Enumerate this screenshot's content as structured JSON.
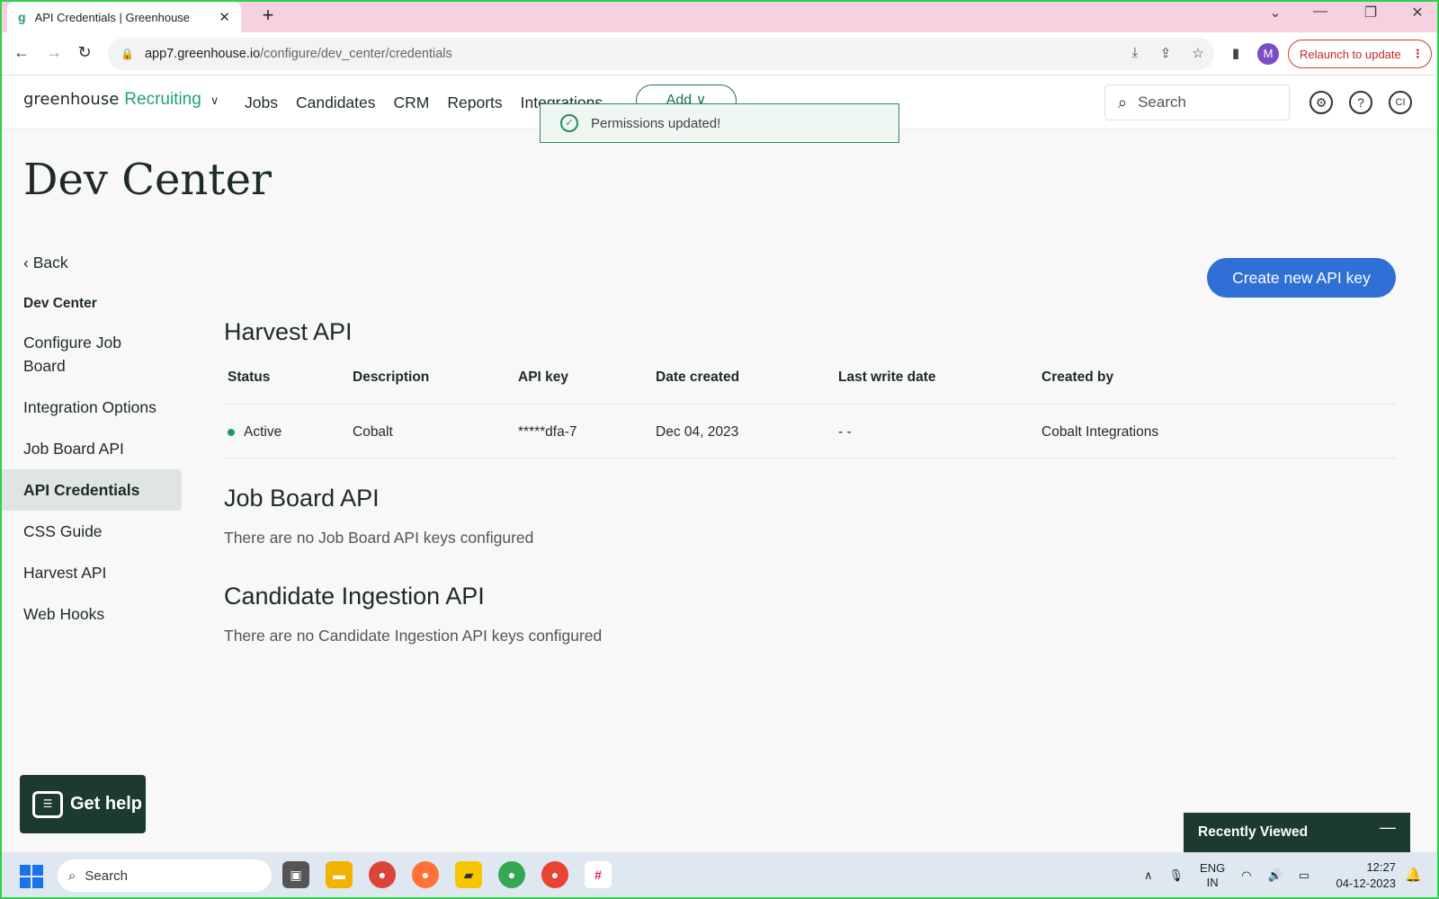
{
  "browser": {
    "tab_title": "API Credentials | Greenhouse",
    "url_host": "app7.greenhouse.io",
    "url_path": "/configure/dev_center/credentials",
    "profile_initial": "M",
    "relaunch_label": "Relaunch to update"
  },
  "header": {
    "logo_text": "greenhouse",
    "logo_product": "Recruiting",
    "nav": [
      "Jobs",
      "Candidates",
      "CRM",
      "Reports",
      "Integrations"
    ],
    "add_label": "Add",
    "search_placeholder": "Search",
    "user_initials": "CI"
  },
  "toast": {
    "message": "Permissions updated!"
  },
  "page": {
    "title": "Dev Center",
    "back_label": "Back",
    "create_button": "Create new API key"
  },
  "sidebar": {
    "heading": "Dev Center",
    "items": [
      {
        "label": "Configure Job Board",
        "active": false
      },
      {
        "label": "Integration Options",
        "active": false
      },
      {
        "label": "Job Board API",
        "active": false
      },
      {
        "label": "API Credentials",
        "active": true
      },
      {
        "label": "CSS Guide",
        "active": false
      },
      {
        "label": "Harvest API",
        "active": false
      },
      {
        "label": "Web Hooks",
        "active": false
      }
    ]
  },
  "harvest": {
    "title": "Harvest API",
    "columns": [
      "Status",
      "Description",
      "API key",
      "Date created",
      "Last write date",
      "Created by"
    ],
    "rows": [
      {
        "status": "Active",
        "description": "Cobalt",
        "api_key": "*****dfa-7",
        "date_created": "Dec 04, 2023",
        "last_write": "- -",
        "created_by": "Cobalt Integrations"
      }
    ]
  },
  "job_board": {
    "title": "Job Board API",
    "empty": "There are no Job Board API keys configured"
  },
  "candidate_ingestion": {
    "title": "Candidate Ingestion API",
    "empty": "There are no Candidate Ingestion API keys configured"
  },
  "help": {
    "label": "Get help"
  },
  "recently_viewed": {
    "label": "Recently Viewed"
  },
  "taskbar": {
    "search_placeholder": "Search",
    "lang_top": "ENG",
    "lang_bottom": "IN",
    "time": "12:27",
    "date": "04-12-2023"
  },
  "colors": {
    "brand_green": "#23a36c",
    "primary_button": "#2f6fd6",
    "active_status": "#1f9a6b",
    "dark_panel": "#1d3a32"
  }
}
